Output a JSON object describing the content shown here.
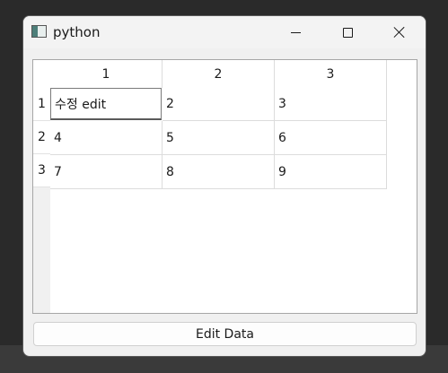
{
  "window": {
    "title": "python"
  },
  "table": {
    "column_headers": [
      "1",
      "2",
      "3"
    ],
    "row_headers": [
      "1",
      "2",
      "3"
    ],
    "rows": [
      [
        "수정 edit",
        "2",
        "3"
      ],
      [
        "4",
        "5",
        "6"
      ],
      [
        "7",
        "8",
        "9"
      ]
    ],
    "editing_cell": "row 1, column 1"
  },
  "footer": {
    "edit_button_label": "Edit Data"
  }
}
